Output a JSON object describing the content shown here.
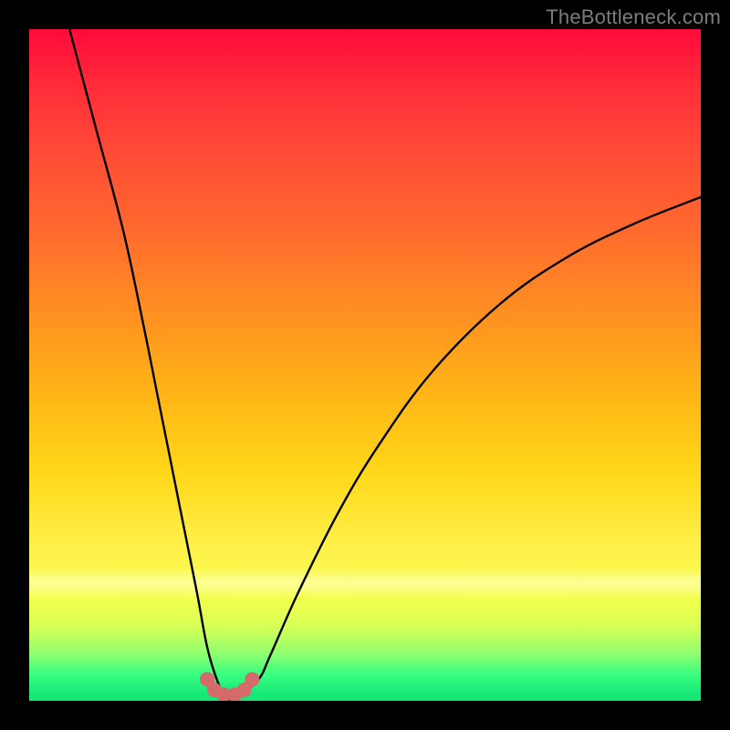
{
  "watermark": {
    "text": "TheBottleneck.com"
  },
  "chart_data": {
    "type": "line",
    "title": "",
    "xlabel": "",
    "ylabel": "",
    "xlim": [
      0,
      100
    ],
    "ylim": [
      0,
      100
    ],
    "grid": false,
    "legend": false,
    "annotations": [],
    "series": [
      {
        "name": "curve",
        "x": [
          6,
          10,
          14,
          17,
          19,
          21,
          23,
          25,
          26.5,
          28,
          29.3,
          30.5,
          34,
          36,
          40,
          46,
          52,
          60,
          70,
          80,
          90,
          100
        ],
        "y": [
          100,
          85,
          70,
          56,
          46,
          36,
          26,
          16,
          8,
          3,
          0.5,
          0.5,
          3,
          7,
          16,
          28,
          38,
          49,
          59,
          66,
          71,
          75
        ]
      }
    ],
    "markers": {
      "name": "bottom-dots",
      "color": "#d46a6a",
      "points": [
        {
          "x": 26.5,
          "y": 3.2
        },
        {
          "x": 27.6,
          "y": 1.6
        },
        {
          "x": 29.0,
          "y": 0.9
        },
        {
          "x": 30.6,
          "y": 0.9
        },
        {
          "x": 32.0,
          "y": 1.6
        },
        {
          "x": 33.2,
          "y": 3.2
        }
      ]
    },
    "background": {
      "type": "vertical-gradient",
      "stops": [
        {
          "pos": 0.0,
          "color": "#ff0a3a"
        },
        {
          "pos": 0.5,
          "color": "#ffb416"
        },
        {
          "pos": 0.8,
          "color": "#fff04a"
        },
        {
          "pos": 0.96,
          "color": "#3aff80"
        },
        {
          "pos": 1.0,
          "color": "#16e876"
        }
      ]
    }
  }
}
